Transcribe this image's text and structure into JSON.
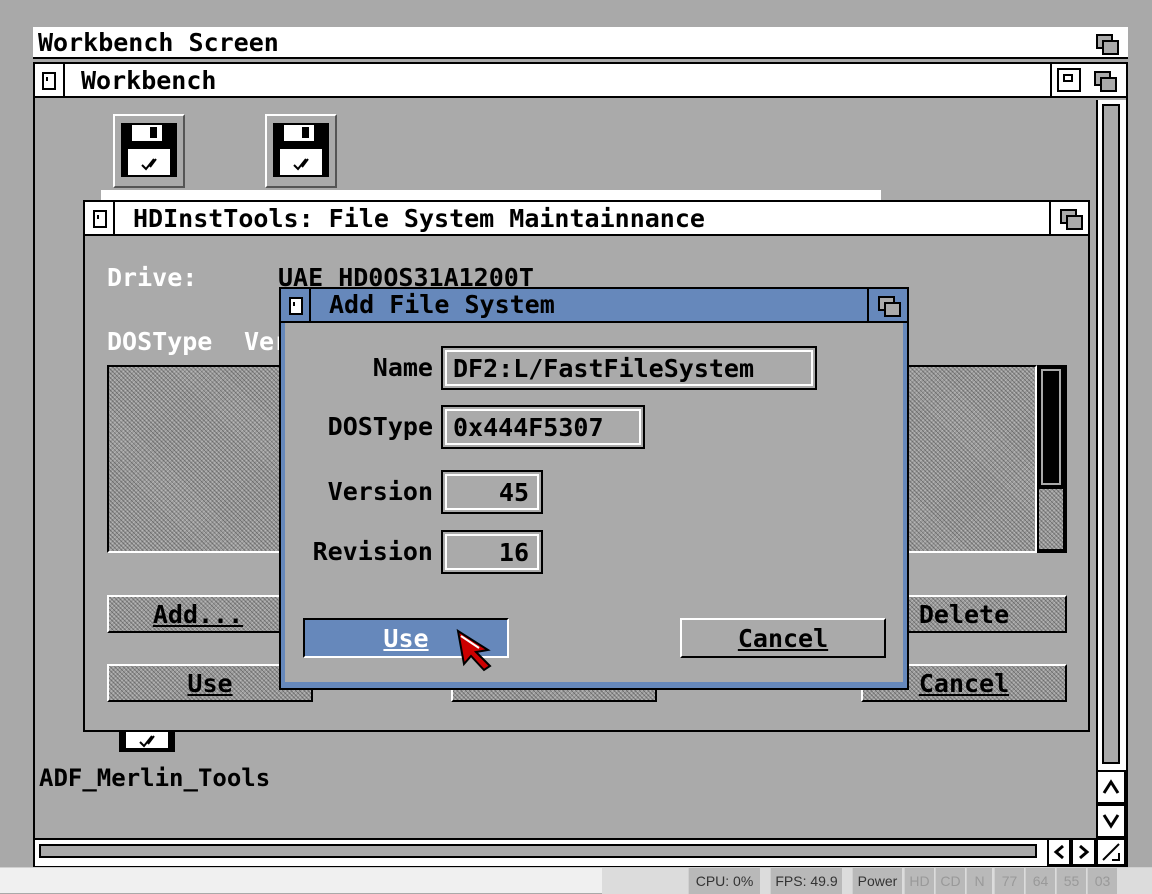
{
  "screen": {
    "title": "Workbench Screen"
  },
  "workbench_window": {
    "title": "Workbench"
  },
  "icons": [
    {
      "label": "ADF_Merlin_Tools",
      "icon": "floppy-disk-icon"
    }
  ],
  "hdinst_window": {
    "title": "HDInstTools: File System Maintainnance",
    "drive_label": "Drive:",
    "drive_value": "UAE HD0OS31A1200T",
    "col_dostype": "DOSType",
    "col_version": "Ver",
    "buttons": {
      "add": "Add...",
      "delete": "Delete",
      "use": "Use",
      "cancel": "Cancel"
    }
  },
  "dialog": {
    "title": "Add File System",
    "fields": {
      "name": {
        "label": "Name",
        "value": "DF2:L/FastFileSystem"
      },
      "dostype": {
        "label": "DOSType",
        "value": "0x444F5307"
      },
      "version": {
        "label": "Version",
        "value": "45"
      },
      "revision": {
        "label": "Revision",
        "value": "16"
      }
    },
    "use_button": "Use",
    "cancel_button": "Cancel"
  },
  "status_bar": {
    "cpu": "CPU: 0%",
    "fps": "FPS: 49.9",
    "power": "Power",
    "hd": "HD",
    "cd": "CD",
    "n": "N",
    "t0": "77",
    "t1": "64",
    "t2": "55",
    "t3": "03"
  },
  "colors": {
    "accent": "#6688bb",
    "pointer": "#cc0000"
  }
}
